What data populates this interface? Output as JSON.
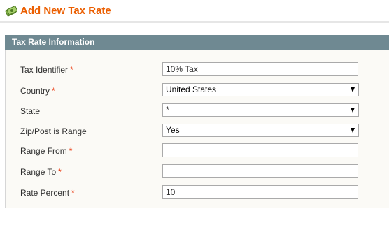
{
  "header": {
    "title": "Add New Tax Rate",
    "icon": "tax-rate-icon",
    "title_color": "#eb5e00"
  },
  "fieldset": {
    "title": "Tax Rate Information",
    "header_color": "#6f8992"
  },
  "form": {
    "tax_identifier": {
      "label": "Tax Identifier",
      "required_mark": "*",
      "value": "10% Tax"
    },
    "country": {
      "label": "Country",
      "required_mark": "*",
      "selected": "United States"
    },
    "state": {
      "label": "State",
      "selected": "*"
    },
    "zip_is_range": {
      "label": "Zip/Post is Range",
      "selected": "Yes"
    },
    "range_from": {
      "label": "Range From",
      "required_mark": "*",
      "value": ""
    },
    "range_to": {
      "label": "Range To",
      "required_mark": "*",
      "value": ""
    },
    "rate_percent": {
      "label": "Rate Percent",
      "required_mark": "*",
      "value": "10"
    }
  },
  "colors": {
    "required": "#eb340a",
    "label_text": "#2f2f2f"
  }
}
